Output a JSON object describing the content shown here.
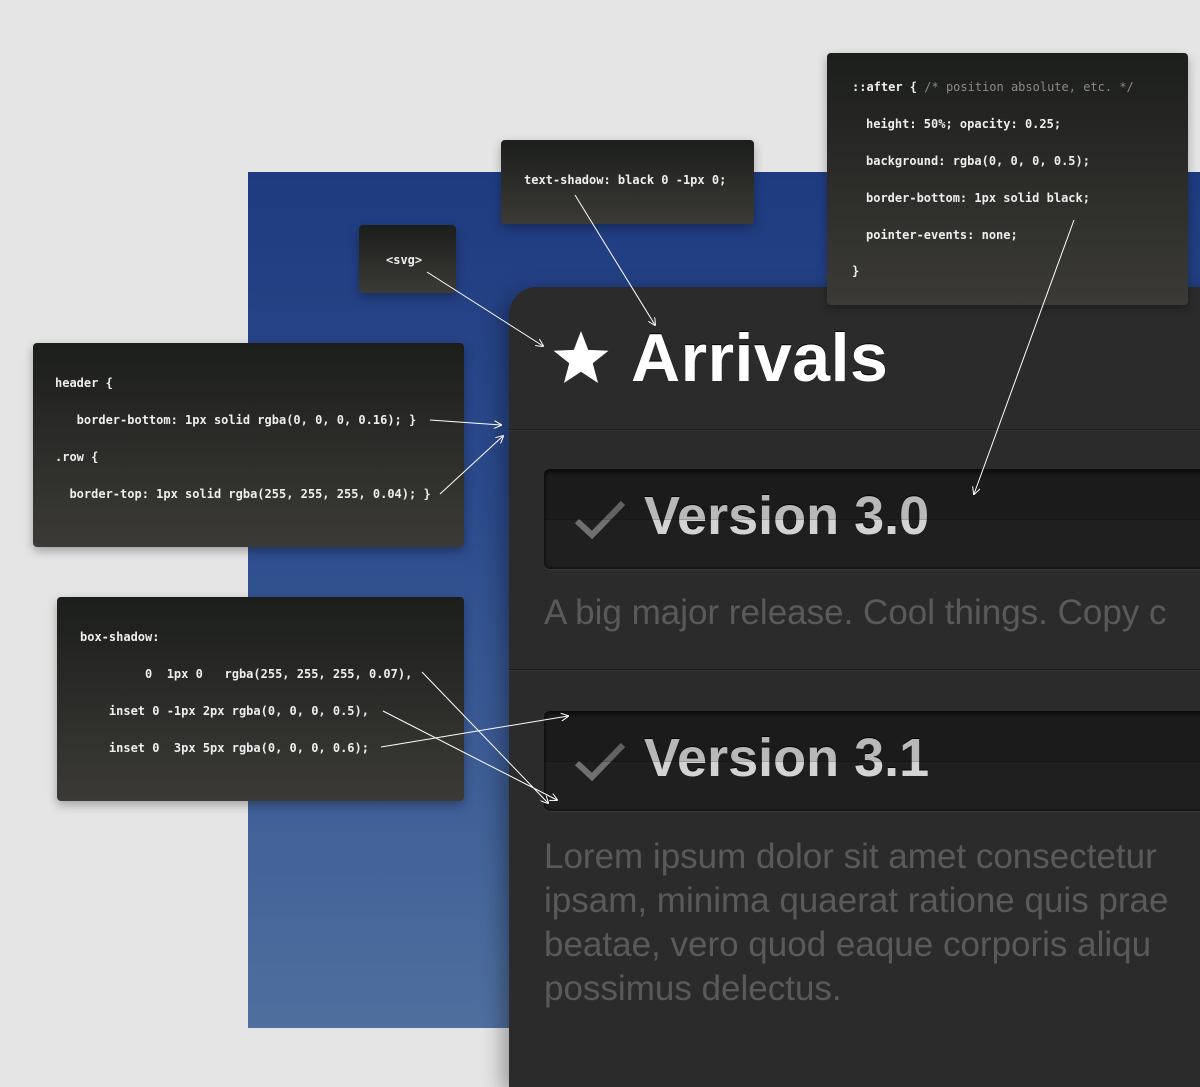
{
  "app": {
    "title": "Arrivals",
    "versions": [
      {
        "title": "Version 3.0",
        "description": "A big major release. Cool things. Copy c"
      },
      {
        "title": "Version 3.1",
        "description": "Lorem ipsum dolor sit amet consectetur ipsam, minima quaerat ratione quis prae beatae, vero quod eaque corporis aliqu possimus delectus."
      }
    ]
  },
  "annotations": {
    "svg_note": "<svg>",
    "text_shadow_note": "text-shadow: black 0 -1px 0;",
    "after_note": {
      "selector": "::after {",
      "comment": "/* position absolute, etc. */",
      "lines": [
        "height: 50%; opacity: 0.25;",
        "background: rgba(0, 0, 0, 0.5);",
        "border-bottom: 1px solid black;",
        "pointer-events: none;",
        "}"
      ]
    },
    "header_note": {
      "lines": [
        "header {",
        "   border-bottom: 1px solid rgba(0, 0, 0, 0.16); }",
        ".row {",
        "  border-top: 1px solid rgba(255, 255, 255, 0.04); }"
      ]
    },
    "box_shadow_note": {
      "lines": [
        "box-shadow:",
        "         0  1px 0   rgba(255, 255, 255, 0.07),",
        "    inset 0 -1px 2px rgba(0, 0, 0, 0.5),",
        "    inset 0  3px 5px rgba(0, 0, 0, 0.6);"
      ]
    }
  },
  "icons": {
    "header": "star-icon",
    "version": "checkmark-icon"
  }
}
